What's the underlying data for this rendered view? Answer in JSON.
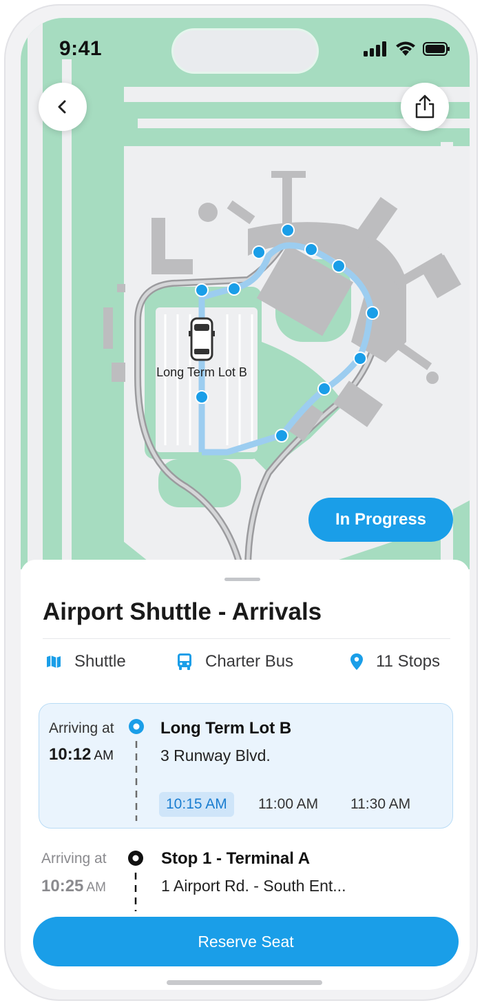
{
  "status_bar": {
    "time": "9:41"
  },
  "map": {
    "lot_label": "Long Term Lot B",
    "status_badge": "In Progress",
    "colors": {
      "grass": "#a6dcc0",
      "pavement": "#eeeff1",
      "building": "#bdbdbf",
      "route": "#1a9ee8"
    }
  },
  "nav": {
    "back_icon": "chevron-left-icon",
    "share_icon": "share-icon"
  },
  "sheet": {
    "title": "Airport Shuttle - Arrivals",
    "meta": [
      {
        "icon": "map-icon",
        "label": "Shuttle"
      },
      {
        "icon": "bus-icon",
        "label": "Charter Bus"
      },
      {
        "icon": "location-pin-icon",
        "label": "11 Stops"
      }
    ],
    "stops": [
      {
        "arriving_label": "Arriving at",
        "time": "10:12",
        "ampm": "AM",
        "name": "Long Term Lot B",
        "address": "3 Runway Blvd.",
        "departures": [
          "10:15 AM",
          "11:00 AM",
          "11:30 AM"
        ],
        "selected_departure": "10:15 AM"
      },
      {
        "arriving_label": "Arriving at",
        "time": "10:25",
        "ampm": "AM",
        "name": "Stop 1 - Terminal A",
        "address": "1 Airport Rd. - South Ent..."
      }
    ],
    "reserve_label": "Reserve Seat"
  },
  "accent": "#1a9ee8"
}
